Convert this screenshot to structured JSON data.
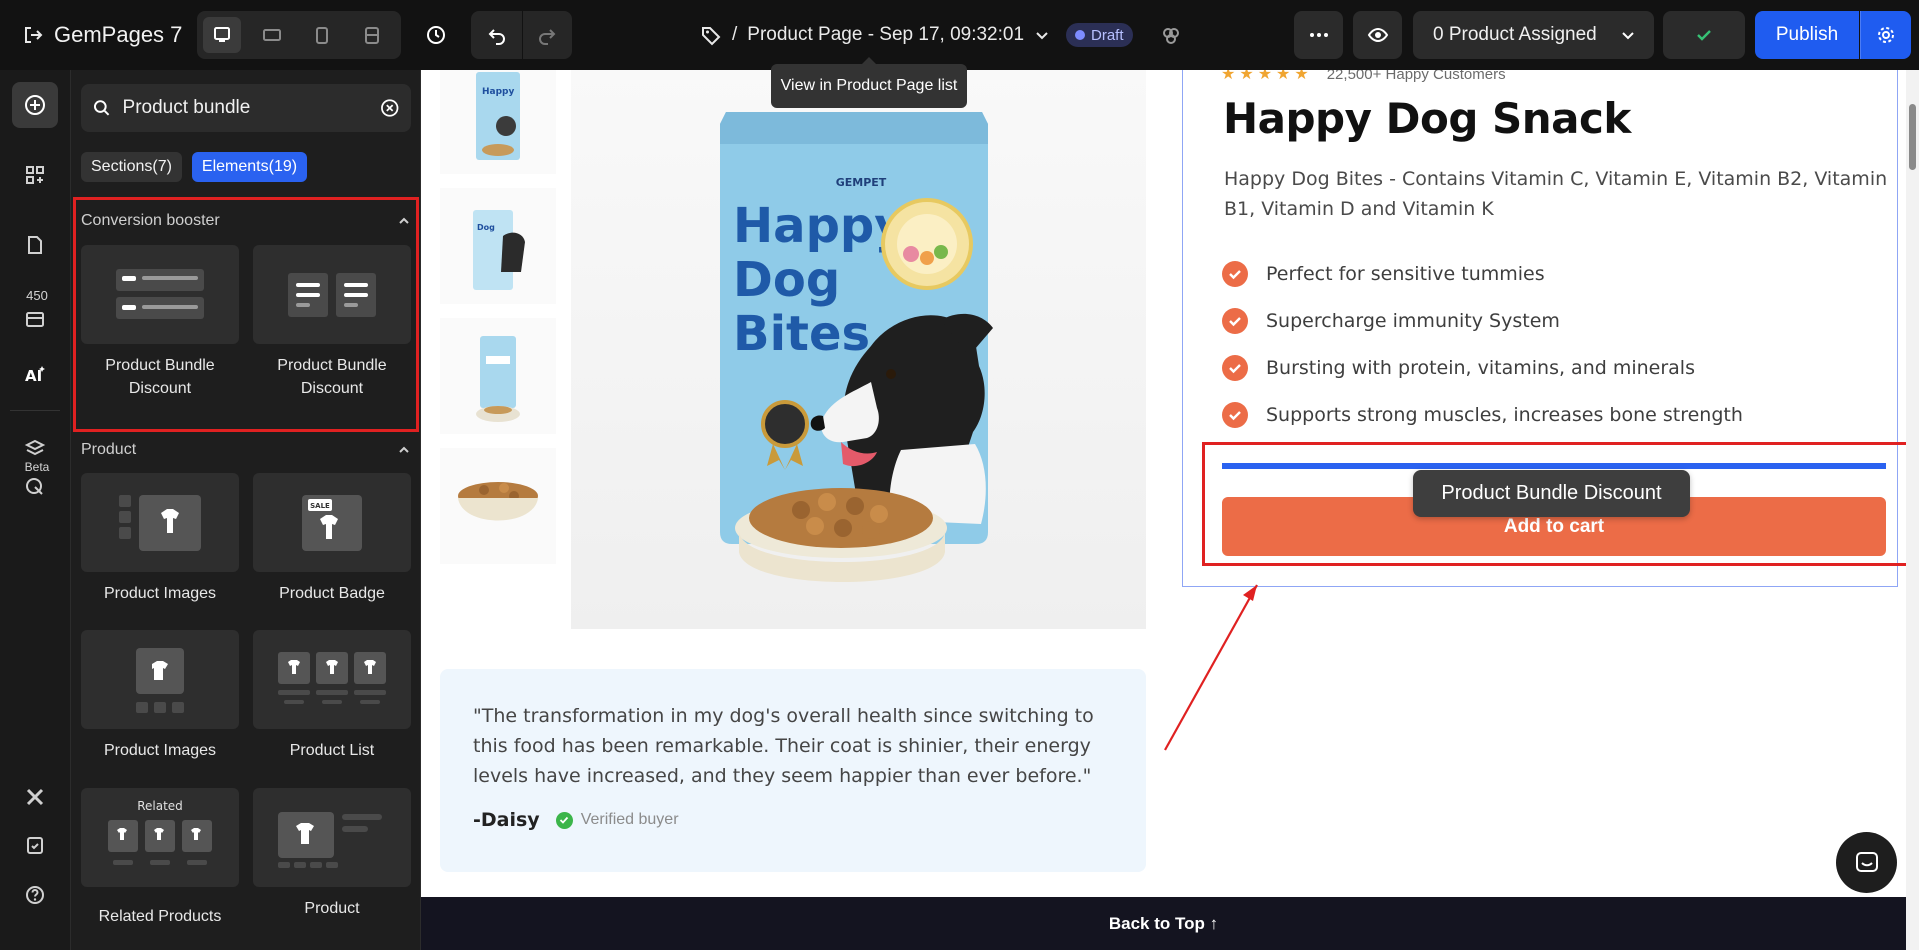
{
  "app": {
    "logo_text": "GemPages 7",
    "page_path_prefix": "/",
    "page_title": "Product Page - Sep 17, 09:32:01",
    "status_badge": "Draft",
    "product_assigned": "0 Product Assigned",
    "publish_label": "Publish",
    "tooltip": "View in Product Page list"
  },
  "rail": {
    "count_badge": "450",
    "beta_label": "Beta"
  },
  "panel": {
    "search_value": "Product bundle",
    "tabs": [
      {
        "label": "Sections(7)",
        "active": false
      },
      {
        "label": "Elements(19)",
        "active": true
      }
    ],
    "groups": [
      {
        "title": "Conversion booster",
        "items": [
          {
            "label": "Product Bundle Discount",
            "icon": "bundle-list-icon"
          },
          {
            "label": "Product Bundle Discount",
            "icon": "bundle-columns-icon"
          }
        ]
      },
      {
        "title": "Product",
        "items": [
          {
            "label": "Product Images",
            "icon": "product-images-icon"
          },
          {
            "label": "Product Badge",
            "icon": "product-badge-icon",
            "badge_text": "SALE"
          },
          {
            "label": "Product Images",
            "icon": "product-images-dots-icon"
          },
          {
            "label": "Product List",
            "icon": "product-list-icon"
          },
          {
            "label": "Related Products",
            "icon": "related-products-icon",
            "thumb_text": "Related"
          },
          {
            "label": "Product",
            "icon": "product-icon"
          }
        ]
      }
    ]
  },
  "canvas": {
    "rating_customers": "22,500+ Happy Customers",
    "product_title": "Happy Dog Snack",
    "product_description": "Happy Dog Bites - Contains Vitamin C, Vitamin E, Vitamin B2, Vitamin B1, Vitamin D and Vitamin K",
    "features": [
      "Perfect for sensitive tummies",
      "Supercharge immunity System",
      "Bursting with protein, vitamins, and minerals",
      "Supports strong muscles, increases bone strength"
    ],
    "add_to_cart": "Add to cart",
    "drag_label": "Product Bundle Discount",
    "package_text": [
      "Happy",
      "Dog",
      "Bites"
    ],
    "package_brand": "GEMPET",
    "review_quote": "\"The transformation in my dog's overall health since switching to this food has been remarkable. Their coat is shinier, their energy levels have increased, and they seem happier than ever before.\"",
    "review_author": "-Daisy",
    "review_verified": "Verified buyer",
    "back_to_top": "Back to Top ↑"
  },
  "colors": {
    "accent_blue": "#2a62f0",
    "cta_orange": "#ec6c47",
    "highlight_red": "#e02121",
    "dark_bg": "#121212"
  }
}
